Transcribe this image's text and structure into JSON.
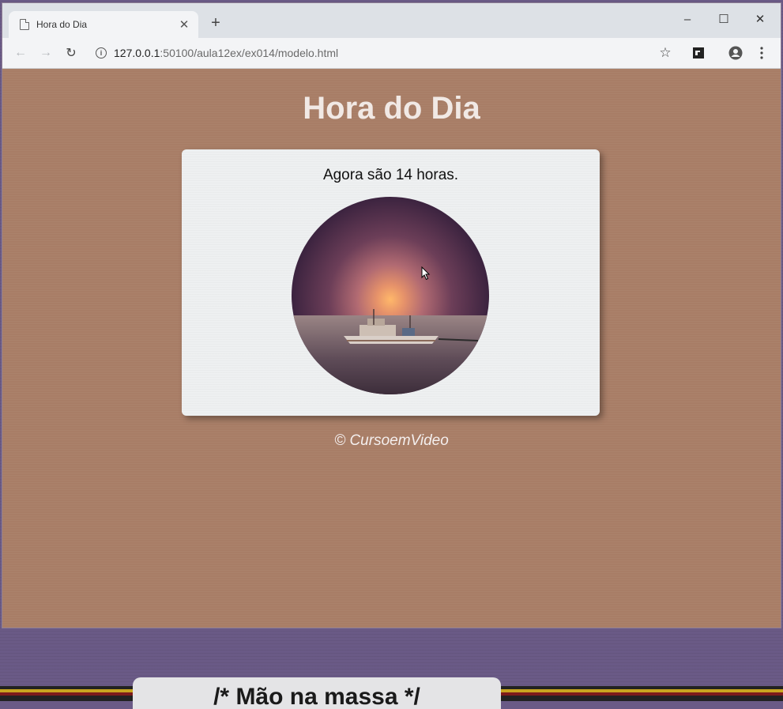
{
  "browser": {
    "tab_title": "Hora do Dia",
    "tab_close": "✕",
    "new_tab": "+",
    "window": {
      "minimize": "–",
      "maximize": "☐",
      "close": "✕"
    },
    "nav": {
      "back": "←",
      "forward": "→",
      "reload": "↻"
    },
    "url_host": "127.0.0.1",
    "url_rest": ":50100/aula12ex/ex014/modelo.html"
  },
  "page": {
    "title": "Hora do Dia",
    "message": "Agora são 14 horas.",
    "footer": "© CursoemVideo"
  },
  "overlay": {
    "bottom_label": "/* Mão na massa */"
  },
  "colors": {
    "page_bg": "#a87d66",
    "card_bg": "#eef0f1",
    "desktop_bg": "#6a5a86"
  }
}
